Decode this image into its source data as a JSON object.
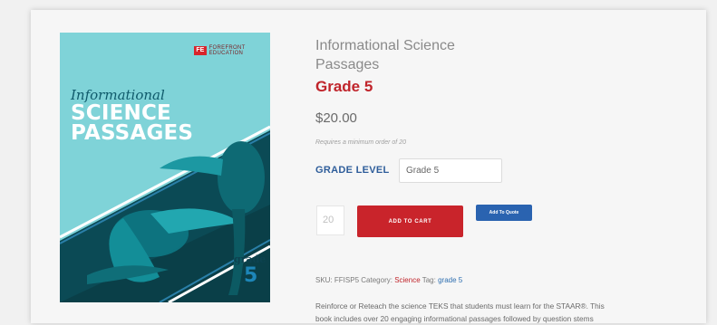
{
  "product": {
    "title_line1": "Informational Science",
    "title_line2": "Passages",
    "grade_title": "Grade 5",
    "price": "$20.00",
    "min_order_note": "Requires a minimum order of 20",
    "grade_level_label": "GRADE LEVEL",
    "grade_level_value": "Grade 5",
    "quantity": "20",
    "add_to_cart": "ADD TO CART",
    "add_to_quote": "Add To Quote",
    "sku_label": "SKU:",
    "sku": "FFISP5",
    "category_label": "Category:",
    "category": "Science",
    "tag_label": "Tag:",
    "tag": "grade 5",
    "description_line1": "Reinforce or Reteach the science TEKS that students must learn for the STAAR®. This",
    "description_line2": "book includes over 20 engaging informational passages followed by question stems"
  },
  "cover": {
    "publisher_mark": "FE",
    "publisher_text": "FOREFRONT EDUCATION",
    "small_title": "Informational",
    "big_title_1": "SCIENCE",
    "big_title_2": "PASSAGES",
    "grade_label": "grade",
    "grade_number": "5"
  },
  "colors": {
    "accent_red": "#c9242b",
    "accent_blue": "#2a63b0",
    "cover_teal": "#7fd3d8"
  }
}
